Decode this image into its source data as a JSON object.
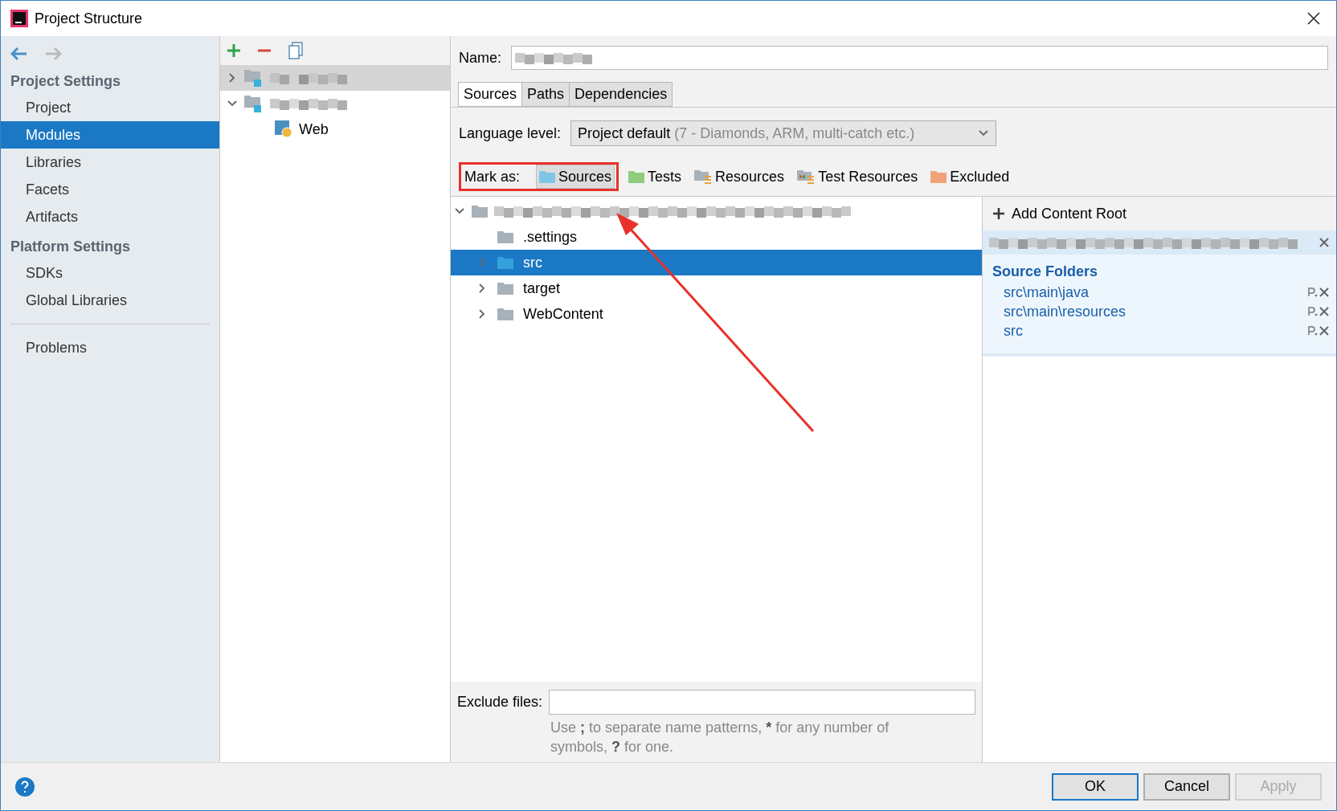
{
  "window": {
    "title": "Project Structure"
  },
  "sidebar": {
    "sections": [
      {
        "heading": "Project Settings",
        "items": [
          {
            "label": "Project",
            "selected": false
          },
          {
            "label": "Modules",
            "selected": true
          },
          {
            "label": "Libraries",
            "selected": false
          },
          {
            "label": "Facets",
            "selected": false
          },
          {
            "label": "Artifacts",
            "selected": false
          }
        ]
      },
      {
        "heading": "Platform Settings",
        "items": [
          {
            "label": "SDKs",
            "selected": false
          },
          {
            "label": "Global Libraries",
            "selected": false
          }
        ]
      }
    ],
    "extra_items": [
      {
        "label": "Problems",
        "selected": false
      }
    ]
  },
  "modules": [
    {
      "expanded": false,
      "selected": true
    },
    {
      "expanded": true,
      "selected": false,
      "children": [
        {
          "label": "Web"
        }
      ]
    }
  ],
  "name_field": {
    "label": "Name:"
  },
  "tabs": [
    {
      "label": "Sources",
      "selected": true
    },
    {
      "label": "Paths",
      "selected": false
    },
    {
      "label": "Dependencies",
      "selected": false
    }
  ],
  "language_level": {
    "label": "Language level:",
    "value": "Project default",
    "hint": "(7 - Diamonds, ARM, multi-catch etc.)"
  },
  "mark_as": {
    "label": "Mark as:",
    "buttons": [
      {
        "label": "Sources",
        "kind": "sources",
        "pressed": true
      },
      {
        "label": "Tests",
        "kind": "tests",
        "pressed": false
      },
      {
        "label": "Resources",
        "kind": "resources",
        "pressed": false
      },
      {
        "label": "Test Resources",
        "kind": "test-resources",
        "pressed": false
      },
      {
        "label": "Excluded",
        "kind": "excluded",
        "pressed": false
      }
    ]
  },
  "content_tree": {
    "expanded": true,
    "children": [
      {
        "label": ".settings",
        "has_children": false,
        "selected": false,
        "kind": "plain"
      },
      {
        "label": "src",
        "has_children": true,
        "selected": true,
        "kind": "source"
      },
      {
        "label": "target",
        "has_children": true,
        "selected": false,
        "kind": "plain"
      },
      {
        "label": "WebContent",
        "has_children": true,
        "selected": false,
        "kind": "plain"
      }
    ]
  },
  "exclude_files": {
    "label": "Exclude files:",
    "hint": [
      {
        "text": "Use ",
        "bold": false
      },
      {
        "text": ";",
        "bold": true
      },
      {
        "text": " to separate name patterns, ",
        "bold": false
      },
      {
        "text": "*",
        "bold": true
      },
      {
        "text": " for any number of symbols, ",
        "bold": false
      },
      {
        "text": "?",
        "bold": true
      },
      {
        "text": " for one.",
        "bold": false
      }
    ]
  },
  "content_root_panel": {
    "add_label": "Add Content Root",
    "heading": "Source Folders",
    "folders": [
      {
        "path": "src\\main\\java"
      },
      {
        "path": "src\\main\\resources"
      },
      {
        "path": "src"
      }
    ]
  },
  "buttons": [
    {
      "label": "OK",
      "default": true,
      "disabled": false
    },
    {
      "label": "Cancel",
      "default": false,
      "disabled": false
    },
    {
      "label": "Apply",
      "default": false,
      "disabled": true
    }
  ]
}
